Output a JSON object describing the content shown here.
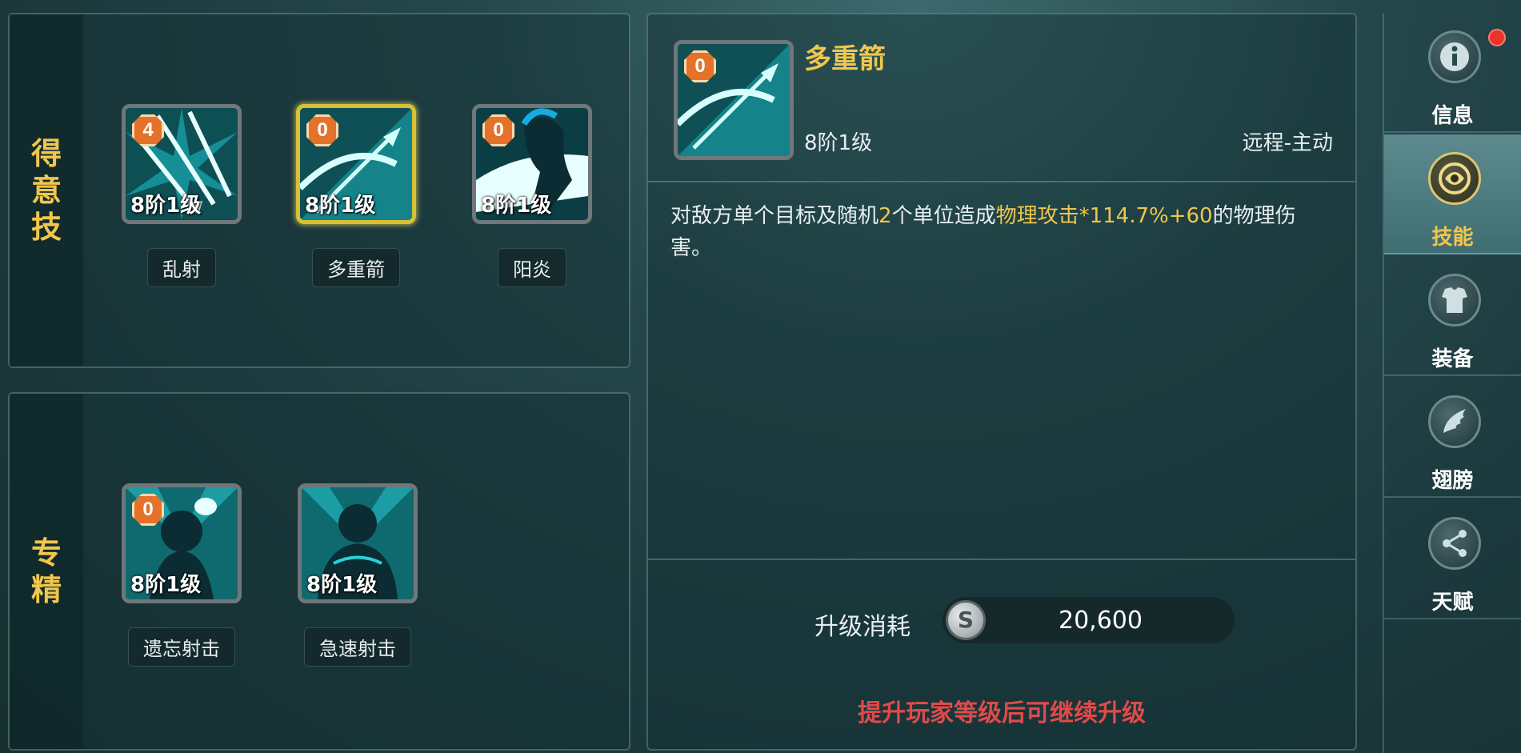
{
  "sections": {
    "favorite": {
      "label_chars": [
        "得",
        "意",
        "技"
      ],
      "skills": [
        {
          "name": "乱射",
          "level": "8阶1级",
          "badge": "4",
          "selected": false
        },
        {
          "name": "多重箭",
          "level": "8阶1级",
          "badge": "0",
          "selected": true
        },
        {
          "name": "阳炎",
          "level": "8阶1级",
          "badge": "0",
          "selected": false
        }
      ]
    },
    "specialty": {
      "label_chars": [
        "专",
        "精"
      ],
      "skills": [
        {
          "name": "遗忘射击",
          "level": "8阶1级",
          "badge": "0"
        },
        {
          "name": "急速射击",
          "level": "8阶1级",
          "badge": ""
        }
      ]
    }
  },
  "detail": {
    "title": "多重箭",
    "badge": "0",
    "level": "8阶1级",
    "type": "远程-主动",
    "description": {
      "part1": "对敌方单个目标及随机",
      "count": "2",
      "part2": "个单位造成",
      "formula": "物理攻击*114.7%+60",
      "part3": "的物理伤害。"
    },
    "cost_label": "升级消耗",
    "coin_symbol": "S",
    "cost_value": "20,600",
    "warning": "提升玩家等级后可继续升级"
  },
  "tabs": [
    {
      "label": "信息",
      "icon": "info-icon",
      "active": false,
      "notification": true
    },
    {
      "label": "技能",
      "icon": "skill-icon",
      "active": true,
      "notification": false
    },
    {
      "label": "装备",
      "icon": "armor-icon",
      "active": false,
      "notification": false
    },
    {
      "label": "翅膀",
      "icon": "wing-icon",
      "active": false,
      "notification": false
    },
    {
      "label": "天赋",
      "icon": "share-icon",
      "active": false,
      "notification": false
    }
  ],
  "colors": {
    "accent_gold": "#f0c64d",
    "warning_red": "#e04a4a",
    "badge_orange": "#e5722a",
    "highlight_cyan": "#19d2de"
  }
}
